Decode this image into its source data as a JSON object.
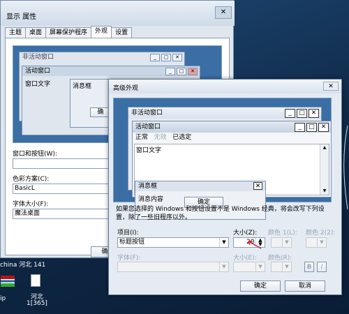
{
  "display_props": {
    "title": "显示 属性",
    "close": "✕",
    "tabs": [
      "主题",
      "桌面",
      "屏幕保护程序",
      "外观",
      "设置"
    ],
    "preview": {
      "inactive": "非活动窗口",
      "active": "活动窗口",
      "window_text": "窗口文字",
      "msgbox": "消息框",
      "ok_fragment": "确"
    },
    "label_windows_buttons": "窗口和按钮(W):",
    "label_color_scheme": "色彩方案(C):",
    "color_scheme_value": "BasicL",
    "label_font_size": "字体大小(F):",
    "font_size_value": "魔法桌面",
    "bottom_button_fragment": "确"
  },
  "advanced": {
    "title": "高级外观",
    "close": "✕",
    "preview": {
      "inactive": "非活动窗口",
      "active": "活动窗口",
      "menu_normal": "正常",
      "menu_disabled": "无效",
      "menu_selected": "已选定",
      "window_text": "窗口文字",
      "msgbox_title": "消息框",
      "msgbox_text": "消息内容",
      "ok": "确定"
    },
    "note": "如果您选择的 Windows 和按钮设置不是 Windows 经典，将会改写下列设置，除了一些旧程序以外。",
    "label_item": "项目(I):",
    "item_value": "标题按钮",
    "label_size": "大小(Z):",
    "size_value": "20",
    "label_color1": "颜色 1(L):",
    "label_color2": "颜色 2(2):",
    "label_font": "字体(F):",
    "label_size2": "大小(E):",
    "label_color3": "颜色(R):",
    "bold": "B",
    "italic": "I",
    "ok": "确定",
    "cancel": "取消"
  },
  "desktop": {
    "left_text": "china 河北 141",
    "icon1_label": "ip",
    "icon2_label": "河北",
    "icon2_sub": "1[365]"
  }
}
